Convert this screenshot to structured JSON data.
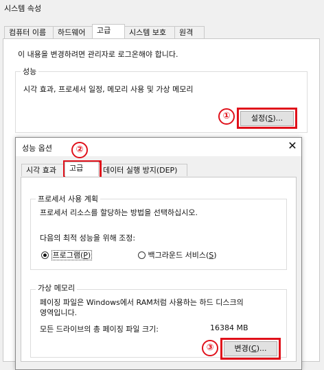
{
  "outer": {
    "title": "시스템 속성",
    "tabs": [
      "컴퓨터 이름",
      "하드웨어",
      "고급",
      "시스템 보호",
      "원격"
    ],
    "admin_note": "이 내용을 변경하려면 관리자로 로그온해야 합니다.",
    "performance": {
      "legend": "성능",
      "description": "시각 효과, 프로세서 일정, 메모리 사용 및 가상 메모리",
      "settings_label": "설정",
      "settings_key": "S"
    }
  },
  "inner": {
    "title": "성능 옵션",
    "close_icon": "close-icon",
    "tabs": [
      "시각 효과",
      "고급",
      "데이터 실행 방지(DEP)"
    ],
    "processor": {
      "legend": "프로세서 사용 계획",
      "description": "프로세서 리소스를 할당하는 방법을 선택하십시오.",
      "adjust_label": "다음의 최적 성능을 위해 조정:",
      "option_programs": "프로그램",
      "option_programs_key": "P",
      "option_services": "백그라운드 서비스",
      "option_services_key": "S",
      "selected": "프로그램"
    },
    "virtual_memory": {
      "legend": "가상 메모리",
      "description_line1": "페이징 파일은 Windows에서 RAM처럼 사용하는 하드 디스크의",
      "description_line2": "영역입니다.",
      "total_label": "모든 드라이브의 총 페이징 파일 크기:",
      "total_value": "16384 MB",
      "change_label": "변경",
      "change_key": "C"
    }
  },
  "annotations": {
    "badge1": "①",
    "badge2": "②",
    "badge3": "③",
    "highlight_color": "#e0101a"
  }
}
